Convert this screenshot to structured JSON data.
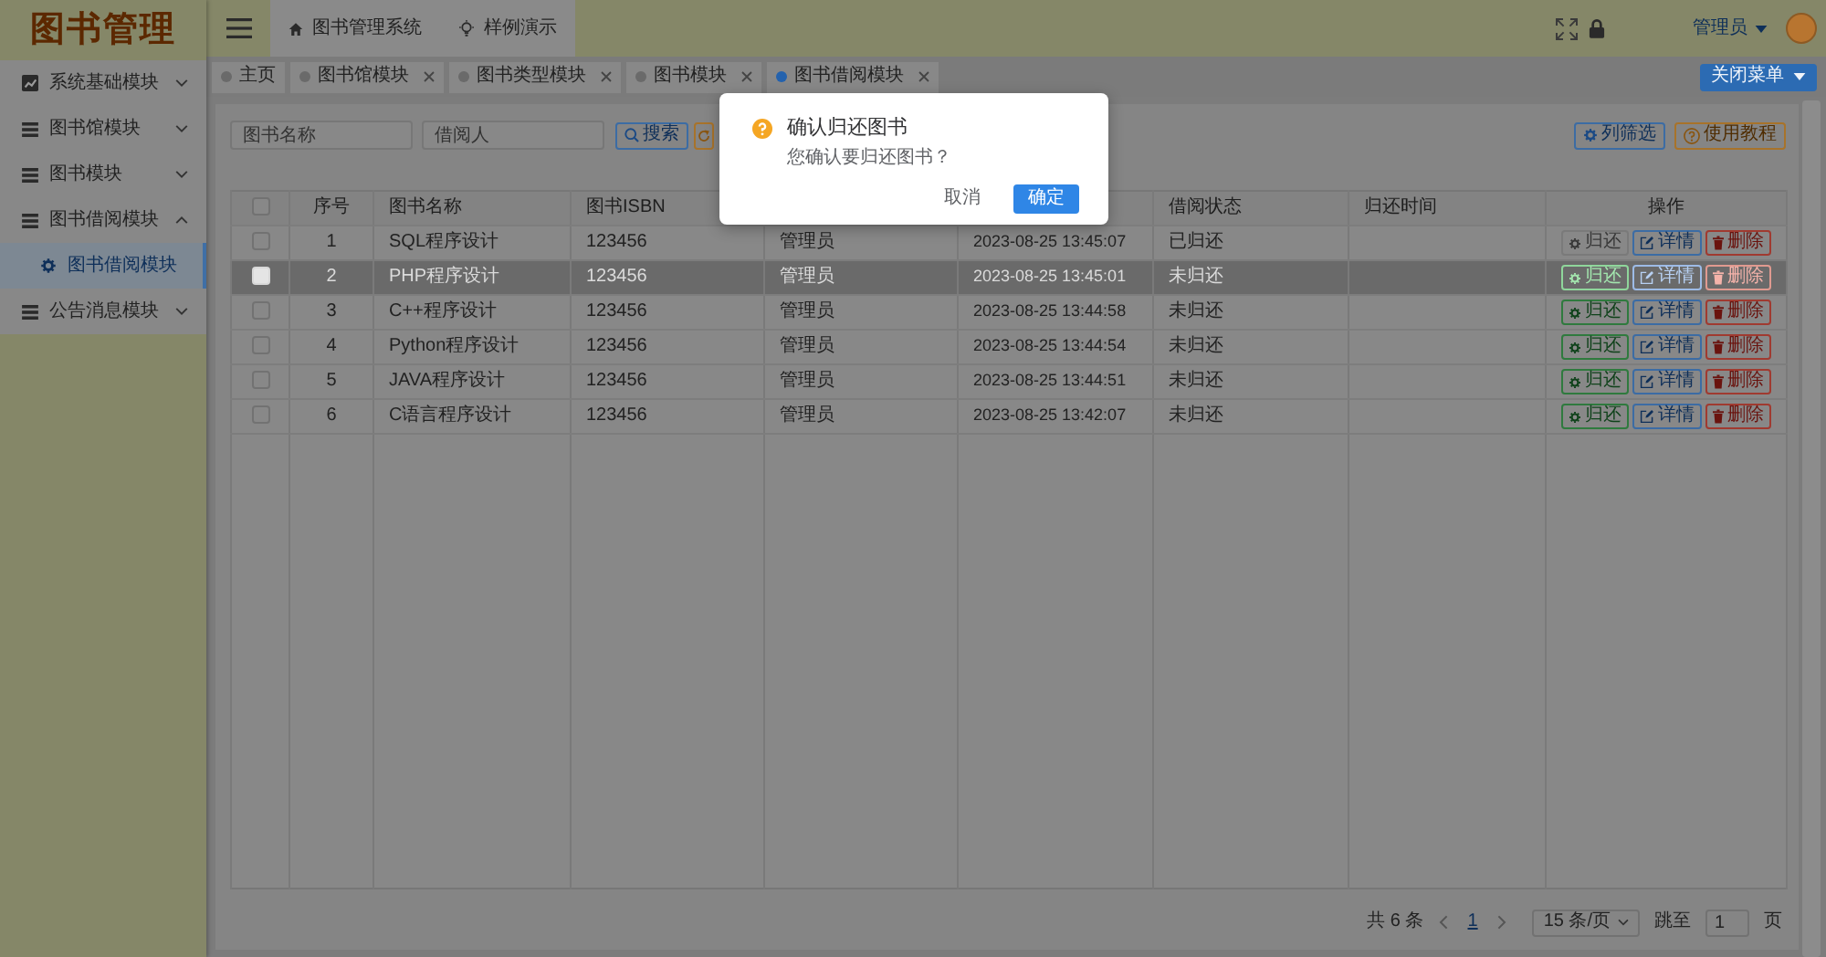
{
  "logo": {
    "text": "图书管理"
  },
  "header": {
    "nav_links": [
      {
        "kind": "home",
        "label": "图书管理系统"
      },
      {
        "kind": "demo",
        "label": "样例演示"
      }
    ],
    "user": "管理员"
  },
  "sidebar": {
    "items": [
      {
        "kind": "chart",
        "label": "系统基础模块",
        "expanded": false
      },
      {
        "kind": "list",
        "label": "图书馆模块",
        "expanded": false
      },
      {
        "kind": "list",
        "label": "图书模块",
        "expanded": false
      },
      {
        "kind": "list",
        "label": "图书借阅模块",
        "expanded": true,
        "children": [
          {
            "label": "图书借阅模块",
            "selected": true
          }
        ]
      },
      {
        "kind": "list",
        "label": "公告消息模块",
        "expanded": false
      }
    ]
  },
  "tags": [
    {
      "label": "主页",
      "closable": false,
      "selected": false
    },
    {
      "label": "图书馆模块",
      "closable": true,
      "selected": false
    },
    {
      "label": "图书类型模块",
      "closable": true,
      "selected": false
    },
    {
      "label": "图书模块",
      "closable": true,
      "selected": false
    },
    {
      "label": "图书借阅模块",
      "closable": true,
      "selected": true
    }
  ],
  "close_menu_button": "关闭菜单",
  "search": {
    "fields": [
      {
        "placeholder": "图书名称"
      },
      {
        "placeholder": "借阅人"
      }
    ],
    "search_button": "搜索"
  },
  "tools": [
    {
      "kind": "filter",
      "label": "列筛选"
    },
    {
      "kind": "help",
      "label": "使用教程"
    }
  ],
  "table": {
    "select_all_checked": false,
    "columns": {
      "number": "序号",
      "book_name": "图书名称",
      "isbn": "图书ISBN",
      "status": "借阅状态",
      "return_time": "归还时间",
      "actions": "操作"
    },
    "rows": [
      {
        "selected": false,
        "checked": false,
        "number": "1",
        "book_name": "SQL程序设计",
        "isbn": "123456",
        "column_5": "管理员",
        "column_6": "2023-08-25 13:45:07",
        "status": "已归还",
        "actions": [
          {
            "kind": "return",
            "label": "归还",
            "disabled": true
          },
          {
            "kind": "detail",
            "label": "详情",
            "disabled": false
          },
          {
            "kind": "delete",
            "label": "删除",
            "disabled": false
          }
        ]
      },
      {
        "selected": true,
        "checked": false,
        "number": "2",
        "book_name": "PHP程序设计",
        "isbn": "123456",
        "column_5": "管理员",
        "column_6": "2023-08-25 13:45:01",
        "status": "未归还",
        "actions": [
          {
            "kind": "return",
            "label": "归还",
            "disabled": false
          },
          {
            "kind": "detail",
            "label": "详情",
            "disabled": false
          },
          {
            "kind": "delete",
            "label": "删除",
            "disabled": false
          }
        ]
      },
      {
        "selected": false,
        "checked": false,
        "number": "3",
        "book_name": "C++程序设计",
        "isbn": "123456",
        "column_5": "管理员",
        "column_6": "2023-08-25 13:44:58",
        "status": "未归还",
        "actions": [
          {
            "kind": "return",
            "label": "归还",
            "disabled": false
          },
          {
            "kind": "detail",
            "label": "详情",
            "disabled": false
          },
          {
            "kind": "delete",
            "label": "删除",
            "disabled": false
          }
        ]
      },
      {
        "selected": false,
        "checked": false,
        "number": "4",
        "book_name": "Python程序设计",
        "isbn": "123456",
        "column_5": "管理员",
        "column_6": "2023-08-25 13:44:54",
        "status": "未归还",
        "actions": [
          {
            "kind": "return",
            "label": "归还",
            "disabled": false
          },
          {
            "kind": "detail",
            "label": "详情",
            "disabled": false
          },
          {
            "kind": "delete",
            "label": "删除",
            "disabled": false
          }
        ]
      },
      {
        "selected": false,
        "checked": false,
        "number": "5",
        "book_name": "JAVA程序设计",
        "isbn": "123456",
        "column_5": "管理员",
        "column_6": "2023-08-25 13:44:51",
        "status": "未归还",
        "actions": [
          {
            "kind": "return",
            "label": "归还",
            "disabled": false
          },
          {
            "kind": "detail",
            "label": "详情",
            "disabled": false
          },
          {
            "kind": "delete",
            "label": "删除",
            "disabled": false
          }
        ]
      },
      {
        "selected": false,
        "checked": false,
        "number": "6",
        "book_name": "C语言程序设计",
        "isbn": "123456",
        "column_5": "管理员",
        "column_6": "2023-08-25 13:42:07",
        "status": "未归还",
        "actions": [
          {
            "kind": "return",
            "label": "归还",
            "disabled": false
          },
          {
            "kind": "detail",
            "label": "详情",
            "disabled": false
          },
          {
            "kind": "delete",
            "label": "删除",
            "disabled": false
          }
        ]
      }
    ]
  },
  "pagination": {
    "total": "共 6 条",
    "pages": [
      {
        "label": "1",
        "selected": true
      }
    ],
    "page_size": "15 条/页",
    "jump_label": "跳至",
    "jump_value": "1",
    "page_suffix": "页"
  },
  "dialog": {
    "title": "确认归还图书",
    "message": "您确认要归还图书？",
    "buttons": [
      {
        "kind": "text",
        "label": "取消"
      },
      {
        "kind": "primary",
        "label": "确定"
      }
    ]
  }
}
